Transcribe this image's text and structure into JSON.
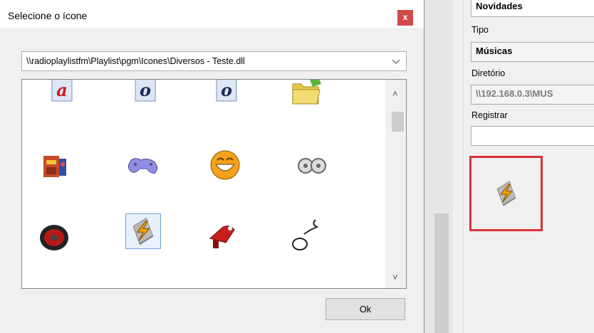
{
  "dialog": {
    "title": "Selecione o ícone",
    "close_label": "x",
    "path_value": "\\\\radioplaylistfm\\Playlist\\pgm\\Icones\\Diversos - Teste.dll",
    "ok_label": "Ok",
    "icons": [
      "red-a-letter-icon",
      "blue-o-letter-icon",
      "blue-o-letter-icon",
      "green-folder-icon",
      "robot-toy-icon",
      "gamepad-icon",
      "laughing-face-icon",
      "cassette-reels-icon",
      "red-speaker-icon",
      "winamp-lightning-icon",
      "red-hair-dryer-icon",
      "noose-rope-icon"
    ],
    "selected_icon": "winamp-lightning-icon"
  },
  "background_form": {
    "field_1_value": "Novidades",
    "tipo_label": "Tipo",
    "tipo_value": "Músicas",
    "diretorio_label": "Diretório",
    "diretorio_value": "\\\\192.168.0.3\\MUS",
    "registrar_label": "Registrar",
    "registrar_value": "",
    "preview_icon": "winamp-lightning-icon",
    "highlight_color": "#d9333a"
  }
}
